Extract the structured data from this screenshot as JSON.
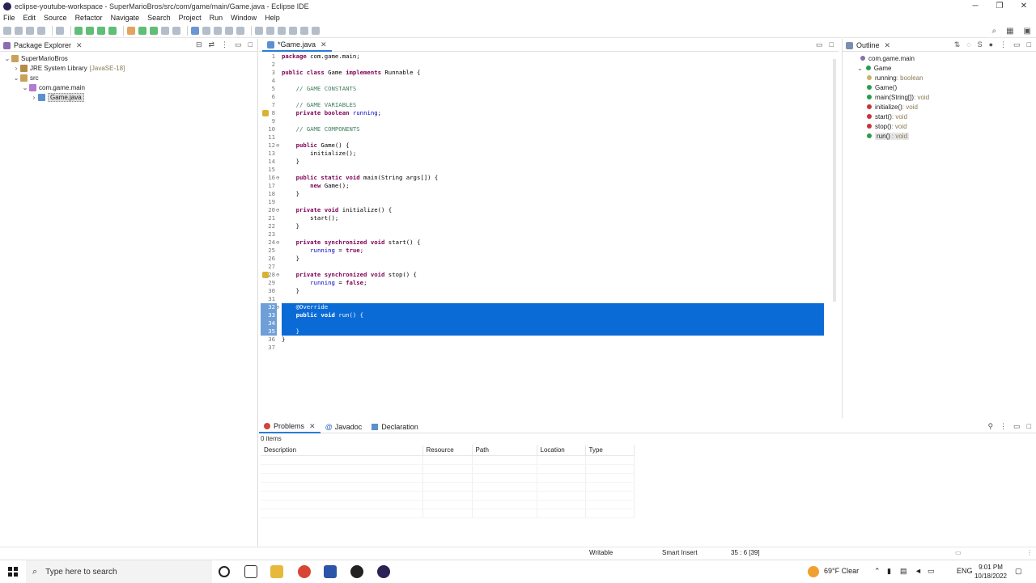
{
  "window": {
    "title": "eclipse-youtube-workspace - SuperMarioBros/src/com/game/main/Game.java - Eclipse IDE"
  },
  "menu": [
    "File",
    "Edit",
    "Source",
    "Refactor",
    "Navigate",
    "Search",
    "Project",
    "Run",
    "Window",
    "Help"
  ],
  "explorer": {
    "title": "Package Explorer",
    "tree": [
      {
        "label": "SuperMarioBros",
        "extra": "",
        "level": 0,
        "twisty": "⌄"
      },
      {
        "label": "JRE System Library",
        "extra": "[JavaSE-18]",
        "level": 1,
        "twisty": "›"
      },
      {
        "label": "src",
        "extra": "",
        "level": 1,
        "twisty": "⌄"
      },
      {
        "label": "com.game.main",
        "extra": "",
        "level": 2,
        "twisty": "⌄"
      },
      {
        "label": "Game.java",
        "extra": "",
        "level": 3,
        "twisty": "›"
      }
    ]
  },
  "editor": {
    "tab_label": "*Game.java",
    "lines": [
      {
        "n": "1",
        "code": "<span class='kw'>package</span> com.game.main;"
      },
      {
        "n": "2",
        "code": ""
      },
      {
        "n": "3",
        "code": "<span class='kw'>public class</span> Game <span class='kw'>implements</span> Runnable {"
      },
      {
        "n": "4",
        "code": ""
      },
      {
        "n": "5",
        "code": "    <span class='cm'>// GAME CONSTANTS</span>"
      },
      {
        "n": "6",
        "code": ""
      },
      {
        "n": "7",
        "code": "    <span class='cm'>// GAME VARIABLES</span>"
      },
      {
        "n": "8",
        "code": "    <span class='kw'>private boolean</span> <span class='fld'>running</span>;"
      },
      {
        "n": "9",
        "code": ""
      },
      {
        "n": "10",
        "code": "    <span class='cm'>// GAME COMPONENTS</span>"
      },
      {
        "n": "11",
        "code": ""
      },
      {
        "n": "12",
        "code": "    <span class='kw'>public</span> Game() {"
      },
      {
        "n": "13",
        "code": "        initialize();"
      },
      {
        "n": "14",
        "code": "    }"
      },
      {
        "n": "15",
        "code": ""
      },
      {
        "n": "16",
        "code": "    <span class='kw'>public static void</span> main(String args[]) {"
      },
      {
        "n": "17",
        "code": "        <span class='kw'>new</span> Game();"
      },
      {
        "n": "18",
        "code": "    }"
      },
      {
        "n": "19",
        "code": ""
      },
      {
        "n": "20",
        "code": "    <span class='kw'>private void</span> initialize() {"
      },
      {
        "n": "21",
        "code": "        start();"
      },
      {
        "n": "22",
        "code": "    }"
      },
      {
        "n": "23",
        "code": ""
      },
      {
        "n": "24",
        "code": "    <span class='kw'>private synchronized void</span> start() {"
      },
      {
        "n": "25",
        "code": "        <span class='fld'>running</span> = <span class='kw'>true</span>;"
      },
      {
        "n": "26",
        "code": "    }"
      },
      {
        "n": "27",
        "code": ""
      },
      {
        "n": "28",
        "code": "    <span class='kw'>private synchronized void</span> stop() {"
      },
      {
        "n": "29",
        "code": "        <span class='fld'>running</span> = <span class='kw'>false</span>;"
      },
      {
        "n": "30",
        "code": "    }"
      },
      {
        "n": "31",
        "code": ""
      },
      {
        "n": "32",
        "code": "    <span class='an'>@Override</span>"
      },
      {
        "n": "33",
        "code": "    <span class='kw'>public void</span> run() {"
      },
      {
        "n": "34",
        "code": ""
      },
      {
        "n": "35",
        "code": "    }"
      },
      {
        "n": "36",
        "code": "}"
      },
      {
        "n": "37",
        "code": ""
      }
    ],
    "selected_lines": [
      "32",
      "33",
      "34",
      "35"
    ],
    "fold_lines": [
      "12",
      "16",
      "20",
      "24",
      "28",
      "32"
    ],
    "marker_lines": [
      "8",
      "28"
    ]
  },
  "outline": {
    "title": "Outline",
    "items": [
      {
        "label": "com.game.main",
        "type": "",
        "level": 0,
        "color": "#8a6fb0"
      },
      {
        "label": "Game",
        "type": "",
        "level": 0,
        "color": "#2a9d4a"
      },
      {
        "label": "running",
        "type": " : boolean",
        "level": 1,
        "color": "#c9b26a"
      },
      {
        "label": "Game()",
        "type": "",
        "level": 1,
        "color": "#2a9d4a"
      },
      {
        "label": "main(String[])",
        "type": " : void",
        "level": 1,
        "color": "#2a9d4a"
      },
      {
        "label": "initialize()",
        "type": " : void",
        "level": 1,
        "color": "#c8343c"
      },
      {
        "label": "start()",
        "type": " : void",
        "level": 1,
        "color": "#c8343c"
      },
      {
        "label": "stop()",
        "type": " : void",
        "level": 1,
        "color": "#c8343c"
      },
      {
        "label": "run()",
        "type": " : void",
        "level": 1,
        "color": "#2a9d4a"
      }
    ]
  },
  "bottom": {
    "tabs": [
      "Problems",
      "Javadoc",
      "Declaration"
    ],
    "items_count": "0 items",
    "columns": [
      "Description",
      "Resource",
      "Path",
      "Location",
      "Type"
    ]
  },
  "status": {
    "writable": "Writable",
    "insert_mode": "Smart Insert",
    "position": "35 : 6 [39]"
  },
  "taskbar": {
    "search_placeholder": "Type here to search",
    "weather": "69°F  Clear",
    "lang": "ENG",
    "time": "9:01 PM",
    "date": "10/18/2022"
  },
  "colors": {
    "selection": "#0a6bd6",
    "accent": "#2a7bd8",
    "keyword": "#7f0055",
    "comment": "#3f7f5f"
  }
}
